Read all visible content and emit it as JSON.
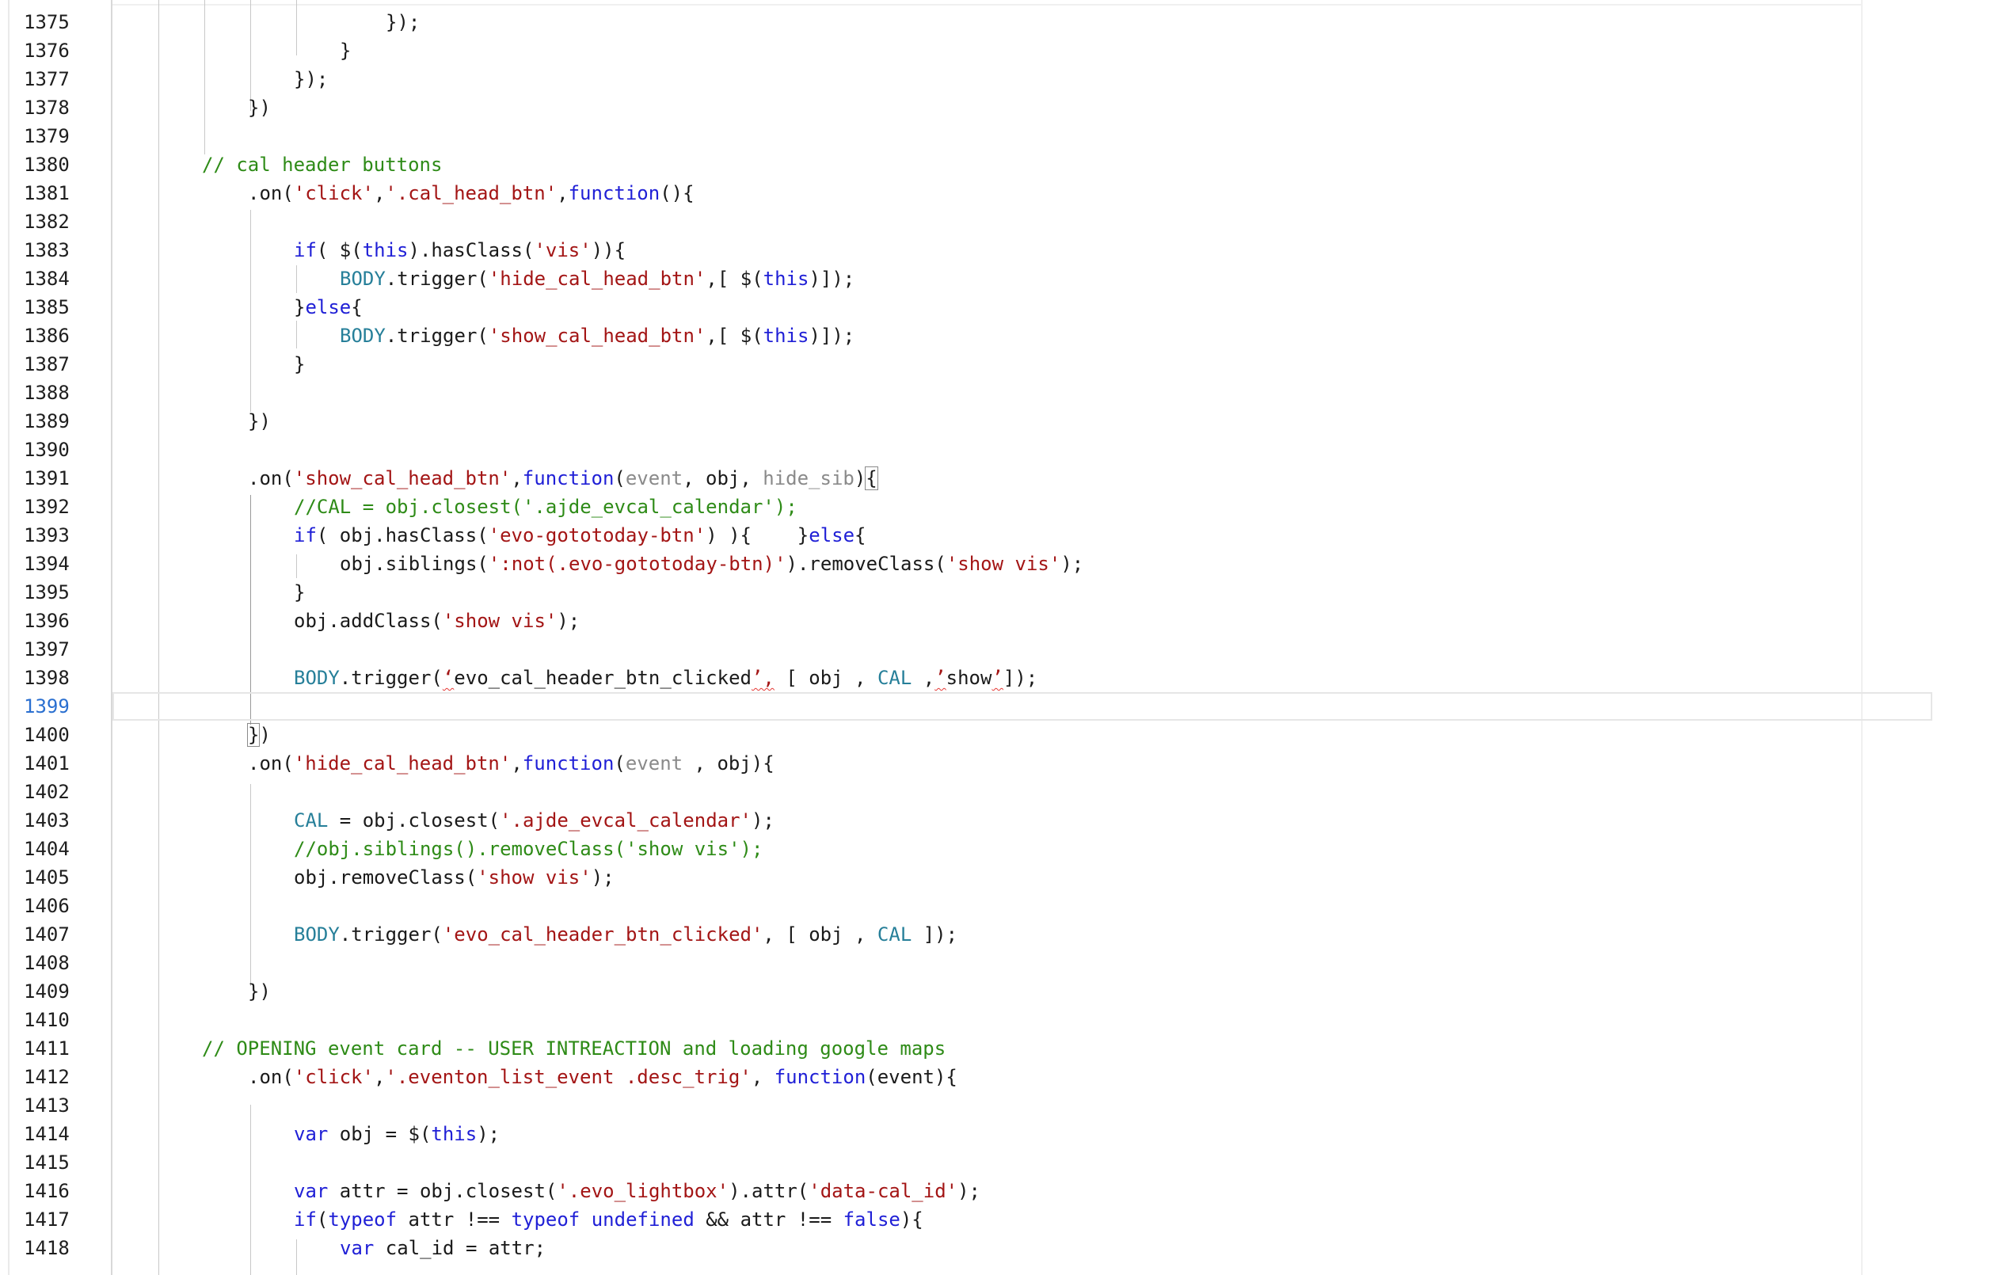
{
  "editor": {
    "current_line": "1399",
    "lines": [
      {
        "n": "1375",
        "i": 4,
        "t": [
          [
            "p",
            "});"
          ]
        ]
      },
      {
        "n": "1376",
        "i": 3,
        "t": [
          [
            "p",
            "}"
          ]
        ]
      },
      {
        "n": "1377",
        "i": 2,
        "t": [
          [
            "p",
            "});"
          ]
        ]
      },
      {
        "n": "1378",
        "i": 1,
        "t": [
          [
            "p",
            "})"
          ]
        ]
      },
      {
        "n": "1379",
        "i": 0,
        "t": []
      },
      {
        "n": "1380",
        "i": 0,
        "t": [
          [
            "c",
            "// cal header buttons"
          ]
        ]
      },
      {
        "n": "1381",
        "i": 1,
        "t": [
          [
            "p",
            ".on("
          ],
          [
            "s",
            "'click'"
          ],
          [
            "p",
            ","
          ],
          [
            "s",
            "'.cal_head_btn'"
          ],
          [
            "p",
            ","
          ],
          [
            "k",
            "function"
          ],
          [
            "p",
            "(){"
          ]
        ]
      },
      {
        "n": "1382",
        "i": 0,
        "t": []
      },
      {
        "n": "1383",
        "i": 2,
        "t": [
          [
            "k",
            "if"
          ],
          [
            "p",
            "( $("
          ],
          [
            "k",
            "this"
          ],
          [
            "p",
            ").hasClass("
          ],
          [
            "s",
            "'vis'"
          ],
          [
            "p",
            ")){"
          ]
        ]
      },
      {
        "n": "1384",
        "i": 3,
        "t": [
          [
            "v",
            "BODY"
          ],
          [
            "p",
            ".trigger("
          ],
          [
            "s",
            "'hide_cal_head_btn'"
          ],
          [
            "p",
            ",[ $("
          ],
          [
            "k",
            "this"
          ],
          [
            "p",
            ")]);"
          ]
        ]
      },
      {
        "n": "1385",
        "i": 2,
        "t": [
          [
            "p",
            "}"
          ],
          [
            "k",
            "else"
          ],
          [
            "p",
            "{"
          ]
        ]
      },
      {
        "n": "1386",
        "i": 3,
        "t": [
          [
            "v",
            "BODY"
          ],
          [
            "p",
            ".trigger("
          ],
          [
            "s",
            "'show_cal_head_btn'"
          ],
          [
            "p",
            ",[ $("
          ],
          [
            "k",
            "this"
          ],
          [
            "p",
            ")]);"
          ]
        ]
      },
      {
        "n": "1387",
        "i": 2,
        "t": [
          [
            "p",
            "}"
          ]
        ]
      },
      {
        "n": "1388",
        "i": 0,
        "t": []
      },
      {
        "n": "1389",
        "i": 1,
        "t": [
          [
            "p",
            "})"
          ]
        ]
      },
      {
        "n": "1390",
        "i": 0,
        "t": []
      },
      {
        "n": "1391",
        "i": 1,
        "t": [
          [
            "p",
            ".on("
          ],
          [
            "s",
            "'show_cal_head_btn'"
          ],
          [
            "p",
            ","
          ],
          [
            "k",
            "function"
          ],
          [
            "p",
            "("
          ],
          [
            "g",
            "event"
          ],
          [
            "p",
            ", obj, "
          ],
          [
            "g",
            "hide_sib"
          ],
          [
            "p",
            ")"
          ],
          [
            "b",
            "{"
          ]
        ]
      },
      {
        "n": "1392",
        "i": 2,
        "t": [
          [
            "c",
            "//CAL = obj.closest('.ajde_evcal_calendar');"
          ]
        ]
      },
      {
        "n": "1393",
        "i": 2,
        "t": [
          [
            "k",
            "if"
          ],
          [
            "p",
            "( obj.hasClass("
          ],
          [
            "s",
            "'evo-gototoday-btn'"
          ],
          [
            "p",
            ") ){    }"
          ],
          [
            "k",
            "else"
          ],
          [
            "p",
            "{"
          ]
        ]
      },
      {
        "n": "1394",
        "i": 3,
        "t": [
          [
            "p",
            "obj.siblings("
          ],
          [
            "s",
            "':not(.evo-gototoday-btn)'"
          ],
          [
            "p",
            ").removeClass("
          ],
          [
            "s",
            "'show vis'"
          ],
          [
            "p",
            ");"
          ]
        ]
      },
      {
        "n": "1395",
        "i": 2,
        "t": [
          [
            "p",
            "}"
          ]
        ]
      },
      {
        "n": "1396",
        "i": 2,
        "t": [
          [
            "p",
            "obj.addClass("
          ],
          [
            "s",
            "'show vis'"
          ],
          [
            "p",
            ");"
          ]
        ]
      },
      {
        "n": "1397",
        "i": 0,
        "t": []
      },
      {
        "n": "1398",
        "i": 2,
        "t": [
          [
            "v",
            "BODY"
          ],
          [
            "p",
            ".trigger("
          ],
          [
            "e",
            "‘"
          ],
          [
            "p",
            "evo_cal_header_btn_clicked"
          ],
          [
            "e",
            "’,"
          ],
          [
            "p",
            " [ obj , "
          ],
          [
            "v",
            "CAL"
          ],
          [
            "p",
            " ,"
          ],
          [
            "e",
            "’"
          ],
          [
            "p",
            "show"
          ],
          [
            "e",
            "’"
          ],
          [
            "p",
            "]);"
          ]
        ]
      },
      {
        "n": "1399",
        "i": 0,
        "t": []
      },
      {
        "n": "1400",
        "i": 1,
        "t": [
          [
            "b",
            "}"
          ],
          [
            "p",
            ")"
          ]
        ]
      },
      {
        "n": "1401",
        "i": 1,
        "t": [
          [
            "p",
            ".on("
          ],
          [
            "s",
            "'hide_cal_head_btn'"
          ],
          [
            "p",
            ","
          ],
          [
            "k",
            "function"
          ],
          [
            "p",
            "("
          ],
          [
            "g",
            "event"
          ],
          [
            "p",
            " , obj){"
          ]
        ]
      },
      {
        "n": "1402",
        "i": 0,
        "t": []
      },
      {
        "n": "1403",
        "i": 2,
        "t": [
          [
            "v",
            "CAL"
          ],
          [
            "p",
            " = obj.closest("
          ],
          [
            "s",
            "'.ajde_evcal_calendar'"
          ],
          [
            "p",
            ");"
          ]
        ]
      },
      {
        "n": "1404",
        "i": 2,
        "t": [
          [
            "c",
            "//obj.siblings().removeClass('show vis');"
          ]
        ]
      },
      {
        "n": "1405",
        "i": 2,
        "t": [
          [
            "p",
            "obj.removeClass("
          ],
          [
            "s",
            "'show vis'"
          ],
          [
            "p",
            ");"
          ]
        ]
      },
      {
        "n": "1406",
        "i": 0,
        "t": []
      },
      {
        "n": "1407",
        "i": 2,
        "t": [
          [
            "v",
            "BODY"
          ],
          [
            "p",
            ".trigger("
          ],
          [
            "s",
            "'evo_cal_header_btn_clicked'"
          ],
          [
            "p",
            ", [ obj , "
          ],
          [
            "v",
            "CAL"
          ],
          [
            "p",
            " ]);"
          ]
        ]
      },
      {
        "n": "1408",
        "i": 0,
        "t": []
      },
      {
        "n": "1409",
        "i": 1,
        "t": [
          [
            "p",
            "})"
          ]
        ]
      },
      {
        "n": "1410",
        "i": 0,
        "t": []
      },
      {
        "n": "1411",
        "i": 0,
        "t": [
          [
            "c",
            "// OPENING event card -- USER INTREACTION and loading google maps"
          ]
        ]
      },
      {
        "n": "1412",
        "i": 1,
        "t": [
          [
            "p",
            ".on("
          ],
          [
            "s",
            "'click'"
          ],
          [
            "p",
            ","
          ],
          [
            "s",
            "'.eventon_list_event .desc_trig'"
          ],
          [
            "p",
            ", "
          ],
          [
            "k",
            "function"
          ],
          [
            "p",
            "(event){"
          ]
        ]
      },
      {
        "n": "1413",
        "i": 0,
        "t": []
      },
      {
        "n": "1414",
        "i": 2,
        "t": [
          [
            "k",
            "var"
          ],
          [
            "p",
            " obj = $("
          ],
          [
            "k",
            "this"
          ],
          [
            "p",
            ");"
          ]
        ]
      },
      {
        "n": "1415",
        "i": 0,
        "t": []
      },
      {
        "n": "1416",
        "i": 2,
        "t": [
          [
            "k",
            "var"
          ],
          [
            "p",
            " attr = obj.closest("
          ],
          [
            "s",
            "'.evo_lightbox'"
          ],
          [
            "p",
            ").attr("
          ],
          [
            "s",
            "'data-cal_id'"
          ],
          [
            "p",
            ");"
          ]
        ]
      },
      {
        "n": "1417",
        "i": 2,
        "t": [
          [
            "k",
            "if"
          ],
          [
            "p",
            "("
          ],
          [
            "k",
            "typeof"
          ],
          [
            "p",
            " attr !== "
          ],
          [
            "k",
            "typeof"
          ],
          [
            "p",
            " "
          ],
          [
            "k",
            "undefined"
          ],
          [
            "p",
            " && attr !== "
          ],
          [
            "k",
            "false"
          ],
          [
            "p",
            "){"
          ]
        ]
      },
      {
        "n": "1418",
        "i": 3,
        "t": [
          [
            "k",
            "var"
          ],
          [
            "p",
            " cal_id = attr;"
          ]
        ]
      }
    ]
  }
}
